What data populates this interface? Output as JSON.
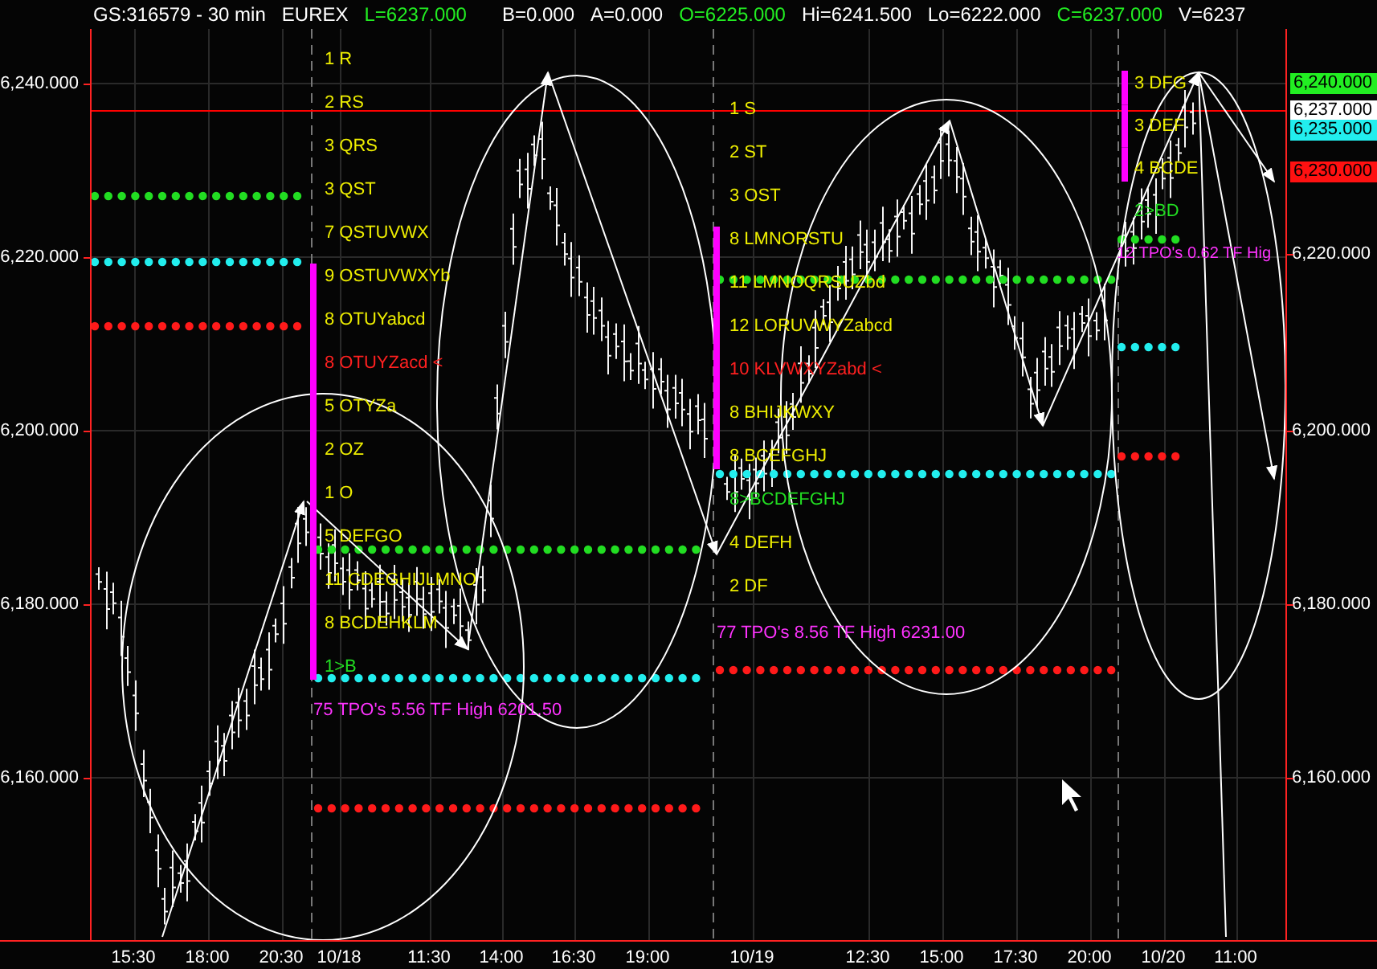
{
  "header": {
    "symbol": "GS:316579 - 30 min",
    "exchange": "EUREX",
    "fields": [
      {
        "text": "L=6237.000",
        "color": "#22ee22"
      },
      {
        "text": "B=0.000",
        "color": "#ffffff"
      },
      {
        "text": "A=0.000",
        "color": "#ffffff"
      },
      {
        "text": "O=6225.000",
        "color": "#22ee22"
      },
      {
        "text": "Hi=6241.500",
        "color": "#ffffff"
      },
      {
        "text": "Lo=6222.000",
        "color": "#ffffff"
      },
      {
        "text": "C=6237.000",
        "color": "#22ee22"
      },
      {
        "text": "V=6237",
        "color": "#ffffff"
      }
    ]
  },
  "left_axis": {
    "ticks": [
      "6,240.000",
      "6,220.000",
      "6,200.000",
      "6,180.000",
      "6,160.000"
    ]
  },
  "right_axis": {
    "ticks": [
      "6,220.000",
      "6,200.000",
      "6,180.000",
      "6,160.000"
    ],
    "price_tags": [
      {
        "text": "6,240.000",
        "color": "#22ee22"
      },
      {
        "text": "6,237.000",
        "color": "#ffffff"
      },
      {
        "text": "6,235.000",
        "color": "#22eeee"
      },
      {
        "text": "6,230.000",
        "color": "#ff1111"
      }
    ]
  },
  "profiles": [
    {
      "rows": [
        {
          "text": "1 R",
          "kind": "normal",
          "value_area": false
        },
        {
          "text": "2 RS",
          "kind": "normal",
          "value_area": false
        },
        {
          "text": "3 QRS",
          "kind": "normal",
          "value_area": false
        },
        {
          "text": "3 QST",
          "kind": "normal",
          "value_area": false
        },
        {
          "text": "7 QSTUVWX",
          "kind": "normal",
          "value_area": false
        },
        {
          "text": "9 OSTUVWXYb",
          "kind": "normal",
          "value_area": true
        },
        {
          "text": "8 OTUYabcd",
          "kind": "normal",
          "value_area": true
        },
        {
          "text": "8 OTUYZacd <",
          "kind": "poc",
          "value_area": true
        },
        {
          "text": "5 OTYZa",
          "kind": "normal",
          "value_area": true
        },
        {
          "text": "2 OZ",
          "kind": "normal",
          "value_area": true
        },
        {
          "text": "1 O",
          "kind": "normal",
          "value_area": true
        },
        {
          "text": "5 DEFGO",
          "kind": "normal",
          "value_area": true
        },
        {
          "text": "11 CDEGHIJLMNO",
          "kind": "normal",
          "value_area": true
        },
        {
          "text": "8 BCDEHKLM",
          "kind": "normal",
          "value_area": true
        },
        {
          "text": "1>B",
          "kind": "open",
          "value_area": true
        }
      ],
      "summary": "75 TPO's 5.56 TF High 6201.50"
    },
    {
      "rows": [
        {
          "text": "1 S",
          "kind": "normal",
          "value_area": false
        },
        {
          "text": "2 ST",
          "kind": "normal",
          "value_area": false
        },
        {
          "text": "3 OST",
          "kind": "normal",
          "value_area": false
        },
        {
          "text": "8 LMNORSTU",
          "kind": "normal",
          "value_area": true
        },
        {
          "text": "11 LMNOQRSUZbd",
          "kind": "normal",
          "value_area": true
        },
        {
          "text": "12 LORUVWYZabcd",
          "kind": "normal",
          "value_area": true
        },
        {
          "text": "10 KLVWXYZabd <",
          "kind": "poc",
          "value_area": true
        },
        {
          "text": "8 BHIJKWXY",
          "kind": "normal",
          "value_area": true
        },
        {
          "text": "8 BCEFGHJ",
          "kind": "normal",
          "value_area": true
        },
        {
          "text": "8>BCDEFGHJ",
          "kind": "open",
          "value_area": false
        },
        {
          "text": "4 DEFH",
          "kind": "normal",
          "value_area": false
        },
        {
          "text": "2 DF",
          "kind": "normal",
          "value_area": false
        }
      ],
      "summary": "77 TPO's 8.56 TF High 6231.00"
    },
    {
      "rows": [
        {
          "text": "3 DFG",
          "kind": "normal",
          "value_area": true
        },
        {
          "text": "3 DEF",
          "kind": "normal",
          "value_area": true
        },
        {
          "text": "4 BCDE",
          "kind": "normal",
          "value_area": true
        },
        {
          "text": "2>BD",
          "kind": "open",
          "value_area": false
        }
      ],
      "summary": "12 TPO's 0.62 TF Hig"
    }
  ],
  "time_axis": {
    "labels": [
      "15:30",
      "18:00",
      "20:30",
      "10/18",
      "11:30",
      "14:00",
      "16:30",
      "19:00",
      "10/19",
      "12:30",
      "15:00",
      "17:30",
      "20:00",
      "10/20",
      "11:00"
    ]
  }
}
